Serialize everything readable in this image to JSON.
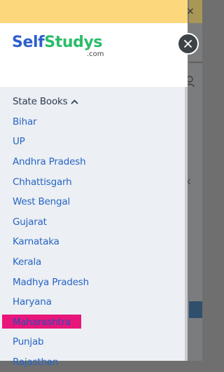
{
  "brand": {
    "name_part1": "Self",
    "name_part2": "Studys",
    "domain": ".com"
  },
  "colors": {
    "accent_blue": "#2565c6",
    "logo_blue": "#2f5fcf",
    "logo_green": "#2bbc6a",
    "highlight_pink": "#e8157b",
    "banner_yellow": "#fdd77c"
  },
  "menu": {
    "header": {
      "label": "State Books",
      "icon": "chevron-up-icon"
    },
    "items": [
      {
        "label": "Bihar"
      },
      {
        "label": "UP"
      },
      {
        "label": "Andhra Pradesh"
      },
      {
        "label": "Chhattisgarh"
      },
      {
        "label": "West Bengal"
      },
      {
        "label": "Gujarat"
      },
      {
        "label": "Karnataka"
      },
      {
        "label": "Kerala"
      },
      {
        "label": "Madhya Pradesh"
      },
      {
        "label": "Haryana"
      },
      {
        "label": "Maharashtra",
        "highlighted": true
      },
      {
        "label": "Punjab"
      },
      {
        "label": "Rajasthan"
      }
    ]
  },
  "icons": {
    "close": "close-icon",
    "background_close": "close-icon",
    "background_user": "user-icon"
  },
  "background": {
    "partial_letter": "k"
  }
}
